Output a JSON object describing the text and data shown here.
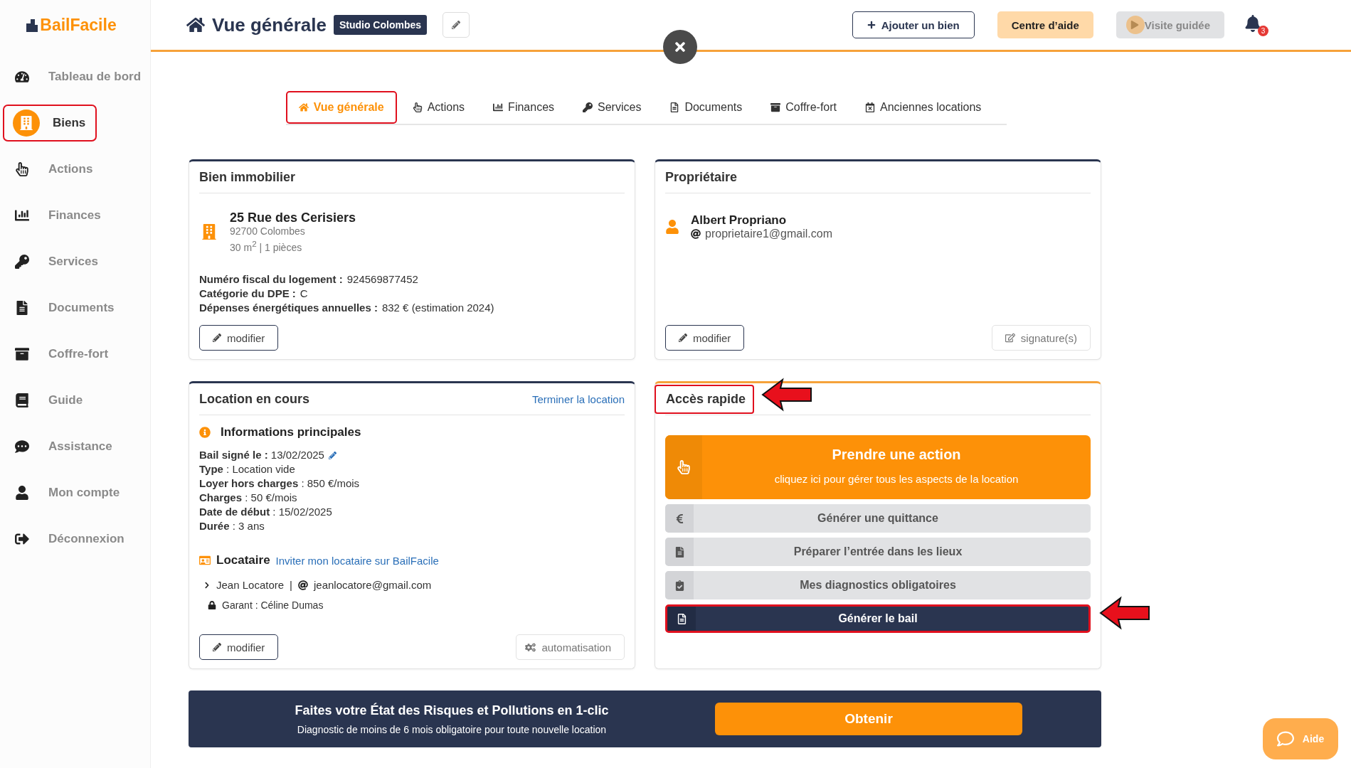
{
  "logo": {
    "text": "BailFacile"
  },
  "sidebar": {
    "items": [
      {
        "label": "Tableau de bord",
        "selected": false,
        "highlighted": false
      },
      {
        "label": "Biens",
        "selected": true,
        "highlighted": true
      },
      {
        "label": "Actions",
        "selected": false,
        "highlighted": false
      },
      {
        "label": "Finances",
        "selected": false,
        "highlighted": false
      },
      {
        "label": "Services",
        "selected": false,
        "highlighted": false
      },
      {
        "label": "Documents",
        "selected": false,
        "highlighted": false
      },
      {
        "label": "Coffre-fort",
        "selected": false,
        "highlighted": false
      },
      {
        "label": "Guide",
        "selected": false,
        "highlighted": false
      },
      {
        "label": "Assistance",
        "selected": false,
        "highlighted": false
      },
      {
        "label": "Mon compte",
        "selected": false,
        "highlighted": false
      },
      {
        "label": "Déconnexion",
        "selected": false,
        "highlighted": false
      }
    ]
  },
  "header": {
    "title": "Vue générale",
    "badge": "Studio Colombes",
    "buttons": [
      {
        "label": "Ajouter un bien",
        "kind": "outline"
      },
      {
        "label": "Centre d’aide",
        "kind": "soft"
      },
      {
        "label": "Visite guidée",
        "kind": "muted"
      }
    ],
    "notification_count": "3"
  },
  "tabs": [
    {
      "label": "Vue générale",
      "selected": true,
      "highlighted": true
    },
    {
      "label": "Actions",
      "selected": false,
      "highlighted": false
    },
    {
      "label": "Finances",
      "selected": false,
      "highlighted": false
    },
    {
      "label": "Services",
      "selected": false,
      "highlighted": false
    },
    {
      "label": "Documents",
      "selected": false,
      "highlighted": false
    },
    {
      "label": "Coffre-fort",
      "selected": false,
      "highlighted": false
    },
    {
      "label": "Anciennes locations",
      "selected": false,
      "highlighted": false
    }
  ],
  "property": {
    "title": "Bien immobilier",
    "address": "25 Rue des Cerisiers",
    "city": "92700 Colombes",
    "size": "30 m$^{2}$ | 1 pièces",
    "fields": [
      "**Numéro fiscal du logement :** 924569877452",
      "**Catégorie du DPE :** C",
      "**Dépenses énergétiques annuelles :** 832 € (estimation 2024)"
    ],
    "button": "modifier"
  },
  "owner": {
    "title": "Propriétaire",
    "name": "Albert Propriano",
    "email": "proprietaire1@gmail.com",
    "buttons": [
      "modifier",
      "signature(s)"
    ]
  },
  "rental": {
    "title": "Location en cours",
    "link": "Terminer la location",
    "section": "Informations principales",
    "fields": [
      "**Bail signé le :** 13/02/2025",
      "**Type** : Location vide",
      "**Loyer hors charges** : 850 €/mois",
      "**Charges** : 50 €/mois",
      "**Date de début** : 15/02/2025",
      "**Durée** : 3 ans"
    ],
    "tenant_heading": "Locataire",
    "invite_link": "Inviter mon locataire sur BailFacile",
    "tenant_name": "Jean Locatore",
    "separator": "|",
    "tenant_email": "jeanlocatore@gmail.com",
    "guarantor": "Garant : Céline Dumas",
    "buttons": [
      "modifier",
      "automatisation"
    ]
  },
  "quick_access": {
    "title": "Accès rapide",
    "highlighted": true,
    "primary": {
      "title": "Prendre une action",
      "subtitle": "cliquez ici pour gérer tous les aspects de la location"
    },
    "items": [
      {
        "label": "Générer une quittance",
        "kind": "muted",
        "highlighted": false
      },
      {
        "label": "Préparer l’entrée dans les lieux",
        "kind": "muted",
        "highlighted": false
      },
      {
        "label": "Mes diagnostics obligatoires",
        "kind": "muted",
        "highlighted": false
      },
      {
        "label": "Générer le bail",
        "kind": "dark",
        "highlighted": true
      }
    ]
  },
  "banner": {
    "title": "Faites votre État des Risques et Pollutions en 1-clic",
    "subtitle": "Diagnostic de moins de 6 mois obligatoire pour toute nouvelle location",
    "button": "Obtenir"
  },
  "help_button": {
    "label": "Aide"
  }
}
